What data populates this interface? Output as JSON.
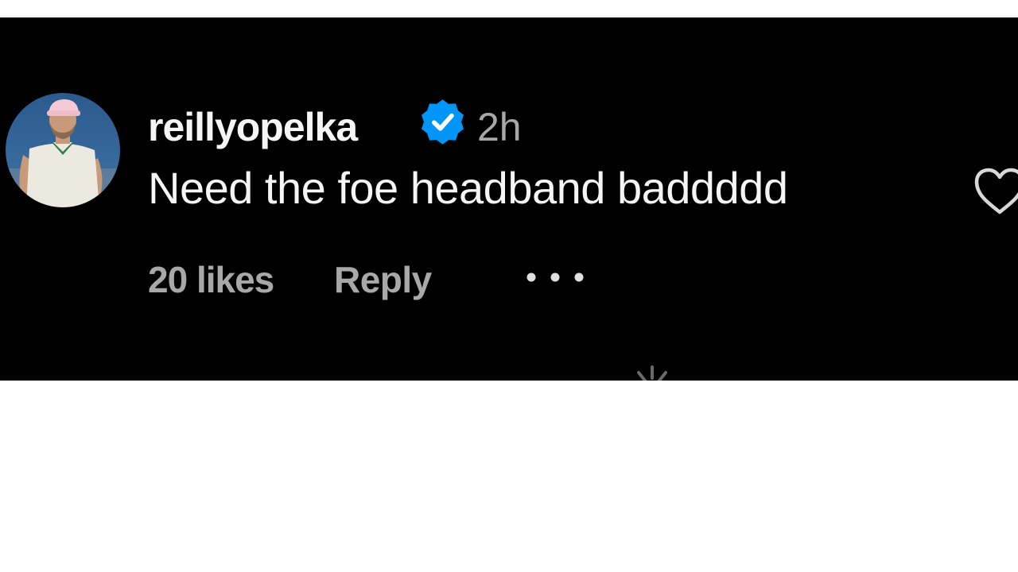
{
  "comment": {
    "username": "reillyopelka",
    "timestamp": "2h",
    "text": "Need the foe headband baddddd",
    "likes": "20 likes",
    "reply_label": "Reply"
  },
  "icons": {
    "verified": "verified-badge-icon",
    "like": "heart-outline-icon",
    "more": "more-options-icon",
    "loading": "loading-spinner-icon"
  },
  "colors": {
    "panel_background": "#000000",
    "primary_text": "#f5f5f5",
    "secondary_text": "#a8a8a8",
    "verified_blue": "#0095f6"
  }
}
